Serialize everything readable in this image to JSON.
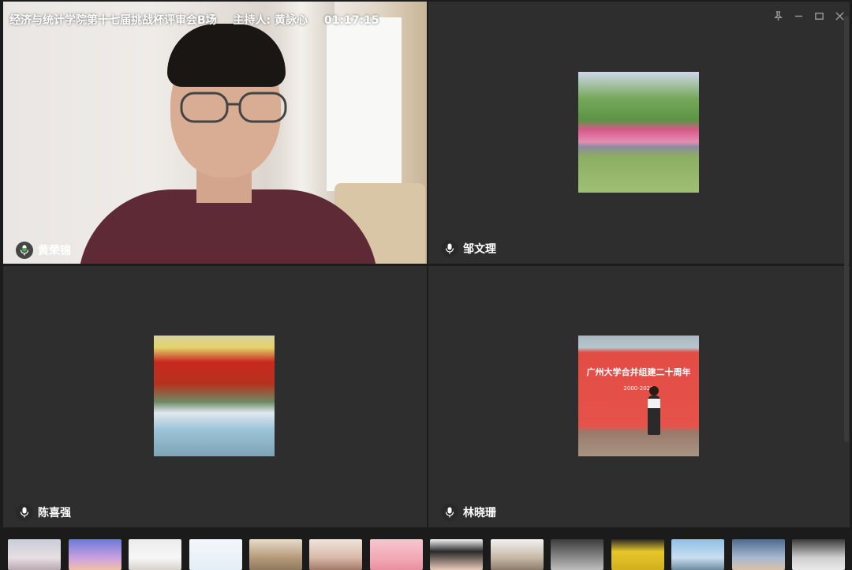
{
  "meeting": {
    "title": "经济与统计学院第十七届挑战杯评审会B场",
    "host_label": "主持人: 黄詠心",
    "elapsed": "01:17:15"
  },
  "window_controls": [
    {
      "name": "pin-icon"
    },
    {
      "name": "minimize-icon"
    },
    {
      "name": "maximize-icon"
    },
    {
      "name": "close-icon"
    }
  ],
  "participants": [
    {
      "name": "黄荣锦",
      "feed": "video",
      "mic": "speaking"
    },
    {
      "name": "邹文理",
      "feed": "avatar",
      "mic": "idle"
    },
    {
      "name": "陈喜强",
      "feed": "avatar",
      "mic": "idle"
    },
    {
      "name": "林晓珊",
      "feed": "avatar",
      "mic": "idle"
    }
  ],
  "event_avatar": {
    "banner": "广州大学合并组建二十周年",
    "years": "2000-2020"
  },
  "colors": {
    "tile_bg": "#2e2e2e",
    "speaking_mic": "#4caf50",
    "idle_mic": "#ffffff"
  },
  "thumbnail_count": 14
}
